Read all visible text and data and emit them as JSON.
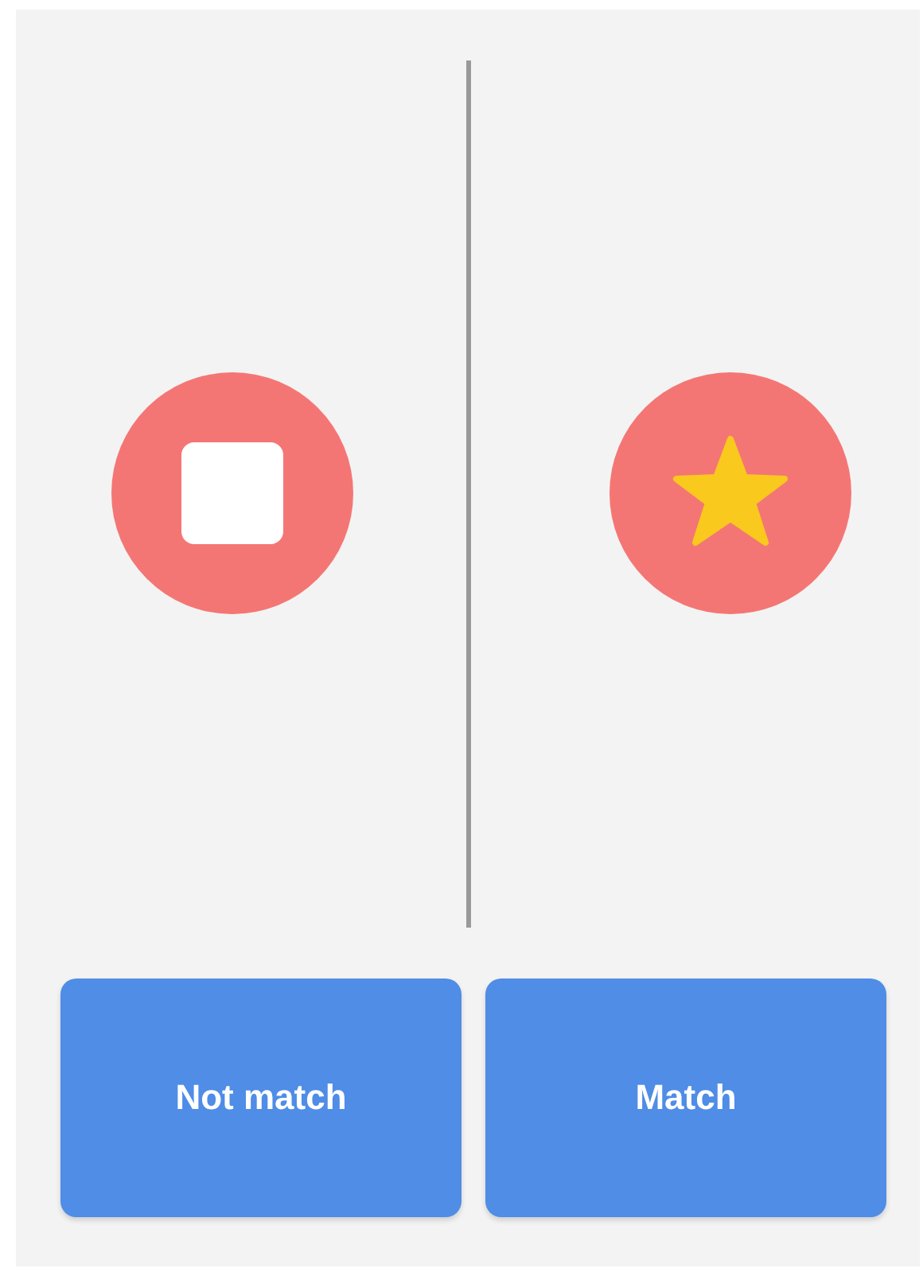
{
  "cards": [
    {
      "kind": "square"
    },
    {
      "kind": "star"
    }
  ],
  "buttons": [
    {
      "label": "Not match"
    },
    {
      "label": "Match"
    }
  ]
}
